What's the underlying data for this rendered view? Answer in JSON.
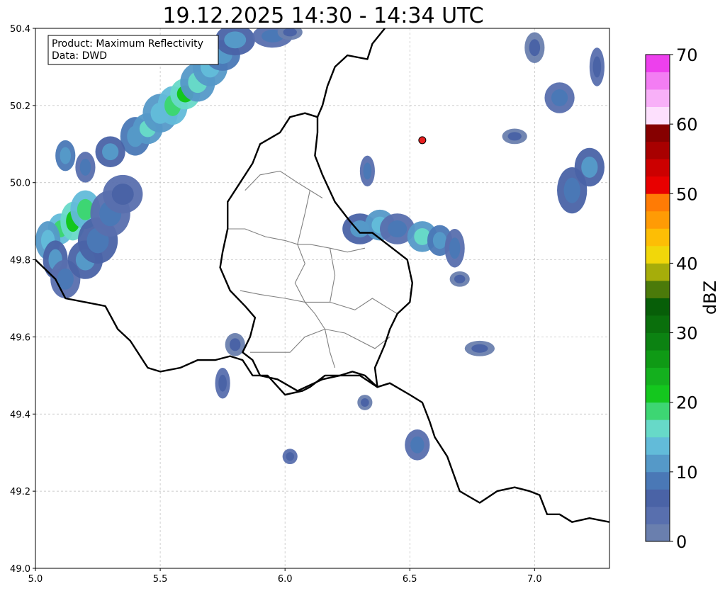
{
  "title": "19.12.2025 14:30 - 14:34 UTC",
  "info_box": {
    "product": "Product: Maximum Reflectivity",
    "data_source": "Data: DWD"
  },
  "map": {
    "lon_range": [
      5.0,
      7.3
    ],
    "lat_range": [
      49.0,
      50.4
    ],
    "lon_ticks": [
      "5.0",
      "5.5",
      "6.0",
      "6.5",
      "7.0"
    ],
    "lat_ticks": [
      "49.0",
      "49.2",
      "49.4",
      "49.6",
      "49.8",
      "50.0",
      "50.2",
      "50.4"
    ],
    "grid": "dashed",
    "colors": {
      "border": "#000000",
      "district": "#808080",
      "grid": "#bbbbbb",
      "marker": "#e82020",
      "marker_edge": "#000000"
    },
    "marker": {
      "lon": 6.55,
      "lat": 50.11
    },
    "national_border": [
      [
        5.0,
        49.8
      ],
      [
        5.08,
        49.75
      ],
      [
        5.12,
        49.7
      ],
      [
        5.2,
        49.69
      ],
      [
        5.28,
        49.68
      ],
      [
        5.33,
        49.62
      ],
      [
        5.38,
        49.59
      ],
      [
        5.45,
        49.52
      ],
      [
        5.5,
        49.51
      ],
      [
        5.58,
        49.52
      ],
      [
        5.65,
        49.54
      ],
      [
        5.72,
        49.54
      ],
      [
        5.78,
        49.55
      ],
      [
        5.83,
        49.54
      ],
      [
        5.87,
        49.5
      ],
      [
        5.93,
        49.5
      ],
      [
        6.0,
        49.45
      ],
      [
        6.07,
        49.46
      ],
      [
        6.1,
        49.47
      ],
      [
        6.16,
        49.5
      ],
      [
        6.22,
        49.5
      ],
      [
        6.3,
        49.5
      ],
      [
        6.37,
        49.47
      ],
      [
        6.42,
        49.48
      ],
      [
        6.5,
        49.45
      ],
      [
        6.55,
        49.43
      ],
      [
        6.58,
        49.38
      ],
      [
        6.6,
        49.34
      ],
      [
        6.65,
        49.29
      ],
      [
        6.7,
        49.2
      ],
      [
        6.78,
        49.17
      ],
      [
        6.85,
        49.2
      ],
      [
        6.92,
        49.21
      ],
      [
        6.98,
        49.2
      ],
      [
        7.02,
        49.19
      ],
      [
        7.05,
        49.14
      ],
      [
        7.1,
        49.14
      ],
      [
        7.15,
        49.12
      ],
      [
        7.22,
        49.13
      ],
      [
        7.3,
        49.12
      ]
    ],
    "luxembourg_border": [
      [
        6.13,
        50.17
      ],
      [
        6.08,
        50.18
      ],
      [
        6.02,
        50.17
      ],
      [
        5.98,
        50.13
      ],
      [
        5.9,
        50.1
      ],
      [
        5.87,
        50.05
      ],
      [
        5.82,
        50.0
      ],
      [
        5.77,
        49.95
      ],
      [
        5.77,
        49.88
      ],
      [
        5.75,
        49.82
      ],
      [
        5.74,
        49.78
      ],
      [
        5.78,
        49.72
      ],
      [
        5.84,
        49.68
      ],
      [
        5.88,
        49.65
      ],
      [
        5.86,
        49.6
      ],
      [
        5.83,
        49.56
      ],
      [
        5.87,
        49.54
      ],
      [
        5.9,
        49.5
      ],
      [
        5.97,
        49.49
      ],
      [
        6.05,
        49.46
      ],
      [
        6.15,
        49.49
      ],
      [
        6.22,
        49.5
      ],
      [
        6.27,
        49.51
      ],
      [
        6.32,
        49.5
      ],
      [
        6.37,
        49.47
      ],
      [
        6.36,
        49.52
      ],
      [
        6.4,
        49.58
      ],
      [
        6.42,
        49.62
      ],
      [
        6.45,
        49.66
      ],
      [
        6.5,
        49.69
      ],
      [
        6.51,
        49.74
      ],
      [
        6.49,
        49.8
      ],
      [
        6.43,
        49.83
      ],
      [
        6.35,
        49.87
      ],
      [
        6.3,
        49.87
      ],
      [
        6.26,
        49.9
      ],
      [
        6.2,
        49.95
      ],
      [
        6.15,
        50.02
      ],
      [
        6.12,
        50.07
      ],
      [
        6.13,
        50.13
      ],
      [
        6.13,
        50.17
      ]
    ],
    "east_border": [
      [
        6.13,
        50.17
      ],
      [
        6.15,
        50.2
      ],
      [
        6.17,
        50.25
      ],
      [
        6.2,
        50.3
      ],
      [
        6.25,
        50.33
      ],
      [
        6.33,
        50.32
      ],
      [
        6.35,
        50.36
      ],
      [
        6.4,
        50.4
      ]
    ],
    "districts": [
      [
        [
          5.84,
          49.98
        ],
        [
          5.9,
          50.02
        ],
        [
          5.98,
          50.03
        ],
        [
          6.05,
          50.0
        ],
        [
          6.1,
          49.98
        ],
        [
          6.15,
          49.96
        ]
      ],
      [
        [
          5.77,
          49.88
        ],
        [
          5.84,
          49.88
        ],
        [
          5.92,
          49.86
        ],
        [
          6.0,
          49.85
        ],
        [
          6.05,
          49.84
        ],
        [
          6.1,
          49.84
        ],
        [
          6.18,
          49.83
        ],
        [
          6.25,
          49.82
        ],
        [
          6.32,
          49.83
        ]
      ],
      [
        [
          6.05,
          49.84
        ],
        [
          6.08,
          49.79
        ],
        [
          6.04,
          49.74
        ],
        [
          6.08,
          49.69
        ],
        [
          6.12,
          49.66
        ],
        [
          6.16,
          49.62
        ]
      ],
      [
        [
          5.82,
          49.72
        ],
        [
          5.9,
          49.71
        ],
        [
          6.0,
          49.7
        ],
        [
          6.08,
          49.69
        ],
        [
          6.18,
          49.69
        ],
        [
          6.28,
          49.67
        ],
        [
          6.35,
          49.7
        ],
        [
          6.45,
          49.66
        ]
      ],
      [
        [
          6.16,
          49.62
        ],
        [
          6.08,
          49.6
        ],
        [
          6.02,
          49.56
        ],
        [
          5.94,
          49.56
        ],
        [
          5.86,
          49.56
        ]
      ],
      [
        [
          6.16,
          49.62
        ],
        [
          6.24,
          49.61
        ],
        [
          6.3,
          49.59
        ],
        [
          6.36,
          49.57
        ],
        [
          6.42,
          49.6
        ]
      ],
      [
        [
          6.16,
          49.62
        ],
        [
          6.18,
          49.56
        ],
        [
          6.2,
          49.52
        ]
      ],
      [
        [
          6.1,
          49.98
        ],
        [
          6.08,
          49.92
        ],
        [
          6.05,
          49.84
        ]
      ],
      [
        [
          6.18,
          49.83
        ],
        [
          6.2,
          49.76
        ],
        [
          6.18,
          49.69
        ]
      ]
    ],
    "radar_cells": [
      [
        5.1,
        49.88,
        0.05,
        0.04,
        18
      ],
      [
        5.15,
        49.9,
        0.05,
        0.05,
        21
      ],
      [
        5.2,
        49.93,
        0.06,
        0.05,
        18
      ],
      [
        5.05,
        49.85,
        0.05,
        0.05,
        14
      ],
      [
        5.08,
        49.8,
        0.05,
        0.05,
        10
      ],
      [
        5.12,
        49.75,
        0.06,
        0.05,
        8
      ],
      [
        5.2,
        49.8,
        0.07,
        0.05,
        10
      ],
      [
        5.25,
        49.85,
        0.08,
        0.06,
        9
      ],
      [
        5.3,
        49.92,
        0.08,
        0.06,
        8
      ],
      [
        5.35,
        49.97,
        0.08,
        0.05,
        7
      ],
      [
        5.4,
        50.12,
        0.06,
        0.05,
        12
      ],
      [
        5.45,
        50.14,
        0.06,
        0.04,
        16
      ],
      [
        5.5,
        50.18,
        0.07,
        0.05,
        14
      ],
      [
        5.55,
        50.2,
        0.06,
        0.05,
        18
      ],
      [
        5.6,
        50.23,
        0.06,
        0.04,
        20
      ],
      [
        5.65,
        50.26,
        0.07,
        0.05,
        16
      ],
      [
        5.7,
        50.3,
        0.07,
        0.05,
        14
      ],
      [
        5.75,
        50.33,
        0.07,
        0.04,
        12
      ],
      [
        5.8,
        50.37,
        0.08,
        0.04,
        10
      ],
      [
        5.3,
        50.08,
        0.06,
        0.04,
        10
      ],
      [
        5.2,
        50.04,
        0.04,
        0.04,
        8
      ],
      [
        5.12,
        50.07,
        0.04,
        0.04,
        12
      ],
      [
        5.95,
        50.38,
        0.08,
        0.03,
        8
      ],
      [
        6.02,
        50.39,
        0.05,
        0.02,
        6
      ],
      [
        6.3,
        49.88,
        0.07,
        0.04,
        10
      ],
      [
        6.38,
        49.89,
        0.06,
        0.04,
        14
      ],
      [
        6.45,
        49.88,
        0.07,
        0.04,
        8
      ],
      [
        6.55,
        49.86,
        0.06,
        0.04,
        16
      ],
      [
        6.62,
        49.85,
        0.05,
        0.04,
        12
      ],
      [
        6.68,
        49.83,
        0.04,
        0.05,
        8
      ],
      [
        7.15,
        49.98,
        0.06,
        0.06,
        9
      ],
      [
        7.22,
        50.04,
        0.06,
        0.05,
        10
      ],
      [
        7.1,
        50.22,
        0.06,
        0.04,
        8
      ],
      [
        7.25,
        50.3,
        0.03,
        0.05,
        7
      ],
      [
        5.8,
        49.58,
        0.04,
        0.03,
        6
      ],
      [
        5.75,
        49.48,
        0.03,
        0.04,
        7
      ],
      [
        6.32,
        49.43,
        0.03,
        0.02,
        6
      ],
      [
        6.02,
        49.29,
        0.03,
        0.02,
        7
      ],
      [
        6.53,
        49.32,
        0.05,
        0.04,
        8
      ],
      [
        6.78,
        49.57,
        0.06,
        0.02,
        6
      ],
      [
        6.33,
        50.03,
        0.03,
        0.04,
        8
      ],
      [
        6.7,
        49.75,
        0.04,
        0.02,
        6
      ],
      [
        7.0,
        50.35,
        0.04,
        0.04,
        6
      ],
      [
        6.92,
        50.12,
        0.05,
        0.02,
        6
      ]
    ]
  },
  "colorbar": {
    "label": "dBZ",
    "vmin": 0,
    "vmax": 70,
    "tick_labels": [
      "0",
      "10",
      "20",
      "30",
      "40",
      "50",
      "60",
      "70"
    ],
    "colors": [
      "#6a7fae",
      "#586fae",
      "#4a63a6",
      "#4a78b6",
      "#5599c8",
      "#62bbd9",
      "#67d9c8",
      "#3dd673",
      "#14c71e",
      "#14b01e",
      "#0f9a15",
      "#0c8212",
      "#0a6f0c",
      "#075e08",
      "#4b7a0a",
      "#a6ad0a",
      "#f1d70a",
      "#fdbe05",
      "#ff9b05",
      "#ff7b05",
      "#e80000",
      "#cc0000",
      "#a80000",
      "#860000",
      "#fde0fd",
      "#f8b0f8",
      "#f37df3",
      "#ed40ed"
    ]
  }
}
